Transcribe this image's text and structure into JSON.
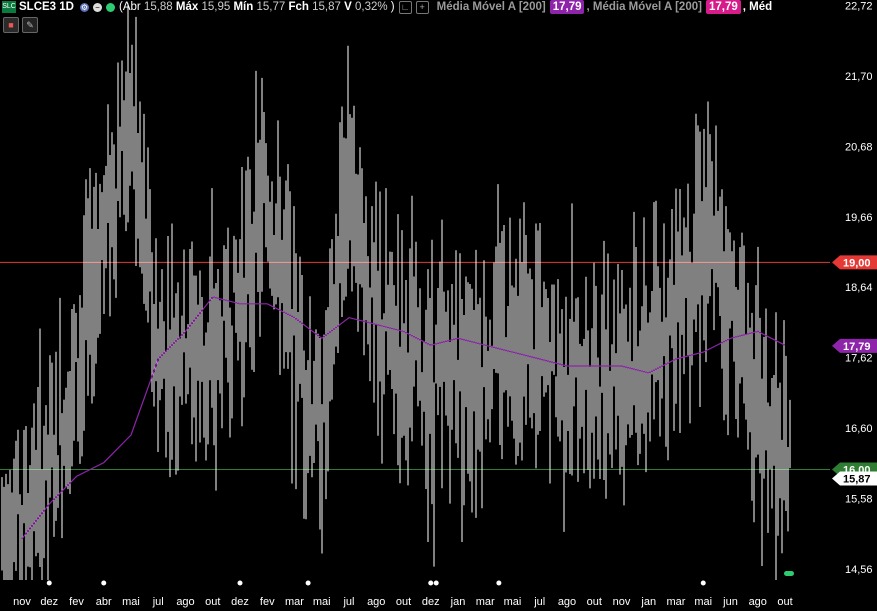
{
  "header": {
    "logo_text": "SLC",
    "symbol": "SLCE3 1D",
    "ohlc": {
      "open_label": "Abr",
      "open": "15,88",
      "high_label": "Máx",
      "high": "15,95",
      "low_label": "Mín",
      "low": "15,77",
      "close_label": "Fch",
      "close": "15,87",
      "var_label": "V",
      "var": "0,32%"
    },
    "indicators": [
      {
        "label": "Média Móvel A [200]",
        "value": "17,79"
      },
      {
        "label": "Média Móvel A [200]",
        "value": "17,79"
      }
    ],
    "indicator_trail": "Méd"
  },
  "chart_data": {
    "type": "line",
    "title": "SLCE3 1D",
    "ylim": [
      14.4,
      22.8
    ],
    "y_ticks": [
      "22,72",
      "21,70",
      "20,68",
      "19,66",
      "18,64",
      "17,62",
      "16,60",
      "15,58",
      "14,56"
    ],
    "x_ticks": [
      "nov",
      "dez",
      "fev",
      "abr",
      "mai",
      "jul",
      "ago",
      "out",
      "dez",
      "fev",
      "mar",
      "mai",
      "jul",
      "ago",
      "out",
      "dez",
      "jan",
      "mar",
      "mai",
      "jul",
      "ago",
      "out",
      "nov",
      "jan",
      "mar",
      "mai",
      "jun",
      "ago",
      "out"
    ],
    "series": [
      {
        "name": "Média Móvel A [200]",
        "color": "#8e24aa",
        "y_by_period": [
          15.0,
          15.5,
          15.9,
          16.1,
          16.5,
          17.6,
          18.0,
          18.5,
          18.4,
          18.4,
          18.2,
          17.9,
          18.2,
          18.1,
          18.0,
          17.8,
          17.9,
          17.8,
          17.7,
          17.6,
          17.5,
          17.5,
          17.5,
          17.4,
          17.6,
          17.7,
          17.9,
          18.0,
          17.8
        ]
      }
    ],
    "price_y_by_period": [
      15.2,
      16.0,
      17.4,
      19.5,
      21.2,
      17.5,
      18.0,
      17.5,
      18.5,
      20.0,
      18.0,
      16.4,
      20.5,
      18.0,
      17.8,
      17.2,
      17.6,
      17.5,
      18.2,
      17.6,
      17.4,
      17.2,
      17.7,
      17.5,
      18.6,
      19.5,
      18.5,
      17.0,
      15.87
    ],
    "horizontal_lines": [
      {
        "value": 19.0,
        "label": "19,00",
        "color": "#e53935"
      },
      {
        "value": 16.0,
        "label": "16,00",
        "color": "#2e7d32"
      }
    ],
    "price_tags": [
      {
        "value": 17.79,
        "label": "17,79",
        "color": "#8e24aa"
      },
      {
        "value": 15.87,
        "label": "15,87",
        "color": "#ffffff"
      }
    ],
    "event_markers_period_index": [
      1,
      3,
      8,
      10.5,
      15,
      15.2,
      17.5,
      25
    ]
  }
}
